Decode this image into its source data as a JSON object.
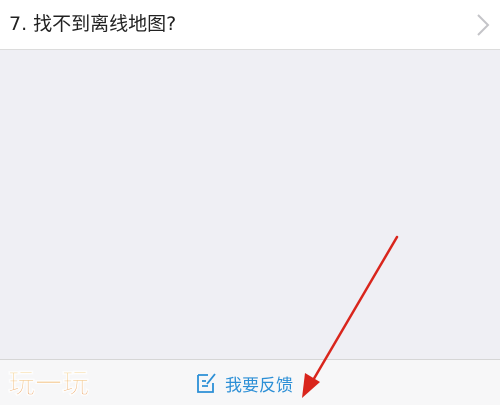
{
  "faq": {
    "item_label": "7. 找不到离线地图?"
  },
  "bottom_bar": {
    "feedback_label": "我要反馈",
    "feedback_icon": "edit-note-icon"
  },
  "watermark": {
    "text": "玩一玩"
  },
  "colors": {
    "page_bg": "#efeff4",
    "row_bg": "#ffffff",
    "accent_blue": "#2c8fd6",
    "annotation_red": "#d9251c",
    "watermark_orange": "#f0a33a"
  }
}
